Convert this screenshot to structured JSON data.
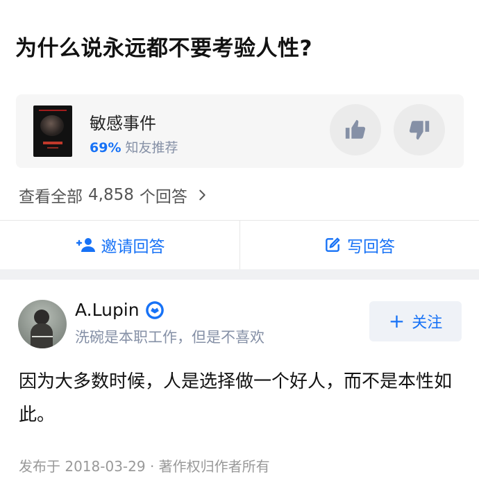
{
  "question": {
    "title": "为什么说永远都不要考验人性?"
  },
  "movie_card": {
    "name": "敏感事件",
    "percent": "69%",
    "recommend_label": "知友推荐",
    "thumbs_up_icon": "thumbs-up-icon",
    "thumbs_down_icon": "thumbs-down-icon"
  },
  "answers_summary": {
    "prefix": "查看全部",
    "count": "4,858",
    "suffix": "个回答",
    "chevron_icon": "chevron-right-icon"
  },
  "actions": {
    "invite_label": "邀请回答",
    "write_label": "写回答"
  },
  "answer": {
    "author": "A.Lupin",
    "bio": "洗碗是本职工作，但是不喜欢",
    "follow_label": "关注",
    "content": "因为大多数时候，人是选择做一个好人，而不是本性如此。",
    "meta": "发布于 2018-03-29 · 著作权归作者所有"
  },
  "colors": {
    "accent": "#1772f6",
    "muted": "#8590a6",
    "card_bg": "#f6f6f6"
  }
}
